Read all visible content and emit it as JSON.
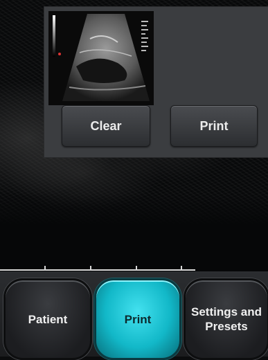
{
  "print_panel": {
    "clear_label": "Clear",
    "print_label": "Print"
  },
  "nav": {
    "patient_label": "Patient",
    "print_label": "Print",
    "settings_label": "Settings and Presets"
  },
  "colors": {
    "active_tab": "#1bc6d6",
    "button_face": "#3a3c40",
    "panel": "#3b3d40"
  },
  "icons": {
    "thumbnail": "ultrasound-image-thumbnail"
  }
}
